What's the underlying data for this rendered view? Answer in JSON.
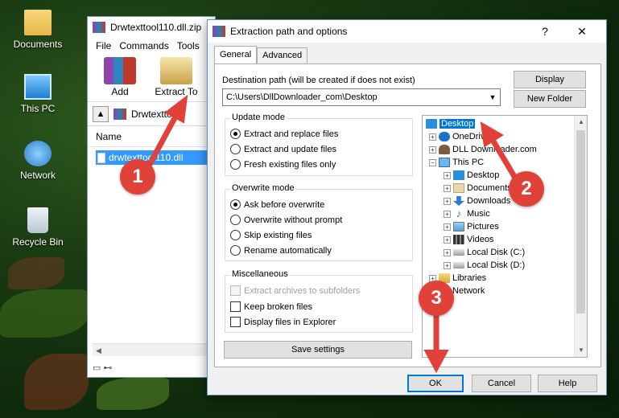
{
  "desktop": {
    "icons": [
      {
        "label": "Documents",
        "icon": "folder-icon"
      },
      {
        "label": "This PC",
        "icon": "computer-icon"
      },
      {
        "label": "Network",
        "icon": "network-icon"
      },
      {
        "label": "Recycle Bin",
        "icon": "recycle-bin-icon"
      }
    ]
  },
  "winrar": {
    "title": "Drwtexttool110.dll.zip",
    "menu": [
      "File",
      "Commands",
      "Tools"
    ],
    "tools": [
      {
        "label": "Add",
        "icon": "add-archive-icon"
      },
      {
        "label": "Extract To",
        "icon": "extract-to-icon"
      }
    ],
    "address": "Drwtexttool",
    "list_header": "Name",
    "file": "drwtexttool110.dll"
  },
  "dialog": {
    "title": "Extraction path and options",
    "help_button": "?",
    "close_button": "✕",
    "tabs": [
      "General",
      "Advanced"
    ],
    "destination_label": "Destination path (will be created if does not exist)",
    "destination_value": "C:\\Users\\DllDownloader_com\\Desktop",
    "display_button": "Display",
    "new_folder_button": "New Folder",
    "update_mode": {
      "title": "Update mode",
      "options": [
        "Extract and replace files",
        "Extract and update files",
        "Fresh existing files only"
      ],
      "selected": 0
    },
    "overwrite_mode": {
      "title": "Overwrite mode",
      "options": [
        "Ask before overwrite",
        "Overwrite without prompt",
        "Skip existing files",
        "Rename automatically"
      ],
      "selected": 0
    },
    "misc": {
      "title": "Miscellaneous",
      "options": [
        "Extract archives to subfolders",
        "Keep broken files",
        "Display files in Explorer"
      ]
    },
    "save_settings": "Save settings",
    "tree": [
      {
        "label": "Desktop",
        "icon": "desktop-icon"
      },
      {
        "label": "OneDrive",
        "icon": "onedrive-icon"
      },
      {
        "label": "DLL Downloader.com",
        "icon": "user-icon"
      },
      {
        "label": "This PC",
        "icon": "computer-icon"
      },
      {
        "label": "Desktop",
        "icon": "desktop-icon"
      },
      {
        "label": "Documents",
        "icon": "documents-icon"
      },
      {
        "label": "Downloads",
        "icon": "downloads-icon"
      },
      {
        "label": "Music",
        "icon": "music-icon"
      },
      {
        "label": "Pictures",
        "icon": "pictures-icon"
      },
      {
        "label": "Videos",
        "icon": "videos-icon"
      },
      {
        "label": "Local Disk (C:)",
        "icon": "drive-icon"
      },
      {
        "label": "Local Disk (D:)",
        "icon": "drive-icon"
      },
      {
        "label": "Libraries",
        "icon": "libraries-icon"
      },
      {
        "label": "Network",
        "icon": "network-icon"
      }
    ],
    "ok_button": "OK",
    "cancel_button": "Cancel",
    "help_btn": "Help"
  },
  "annotations": [
    "1",
    "2",
    "3"
  ],
  "colors": {
    "marker": "#e0423a",
    "selection": "#0078d7",
    "file_highlight": "#3399ff"
  }
}
